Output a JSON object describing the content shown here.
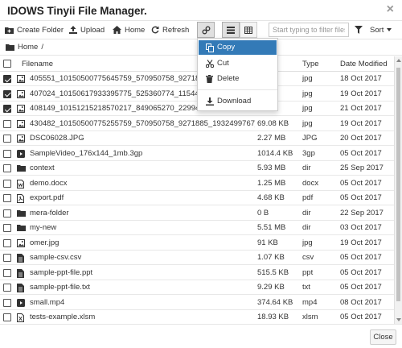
{
  "window": {
    "title": "IDOWS Tinyii File Manager.",
    "close_glyph": "×"
  },
  "toolbar": {
    "create_folder": "Create Folder",
    "upload": "Upload",
    "home": "Home",
    "refresh": "Refresh",
    "filter_placeholder": "Start typing to filter files.",
    "sort": "Sort"
  },
  "breadcrumb": {
    "home": "Home",
    "separator": "/"
  },
  "grid": {
    "columns": {
      "filename": "Filename",
      "size": "",
      "type": "Type",
      "date": "Date Modified"
    },
    "rows": [
      {
        "name": "405551_10150500775645759_570950758_9271888_",
        "size": "KB",
        "type": "jpg",
        "date": "18 Oct 2017",
        "icon": "image-icon",
        "checked": true
      },
      {
        "name": "407024_10150617933395775_525360774_11544833",
        "size": "KB",
        "type": "jpg",
        "date": "19 Oct 2017",
        "icon": "image-icon",
        "checked": true
      },
      {
        "name": "408149_10151215218570217_849065270_2299490",
        "size": "KB",
        "type": "jpg",
        "date": "21 Oct 2017",
        "icon": "image-icon",
        "checked": true
      },
      {
        "name": "430482_10150500775255759_570950758_9271885_1932499767_n.jpg",
        "size": "69.08 KB",
        "type": "jpg",
        "date": "19 Oct 2017",
        "icon": "image-icon",
        "checked": false
      },
      {
        "name": "DSC06028.JPG",
        "size": "2.27 MB",
        "type": "JPG",
        "date": "20 Oct 2017",
        "icon": "image-icon",
        "checked": false
      },
      {
        "name": "SampleVideo_176x144_1mb.3gp",
        "size": "1014.4 KB",
        "type": "3gp",
        "date": "05 Oct 2017",
        "icon": "video-icon",
        "checked": false
      },
      {
        "name": "context",
        "size": "5.93 MB",
        "type": "dir",
        "date": "25 Sep 2017",
        "icon": "folder-icon",
        "checked": false
      },
      {
        "name": "demo.docx",
        "size": "1.25 MB",
        "type": "docx",
        "date": "05 Oct 2017",
        "icon": "word-icon",
        "checked": false
      },
      {
        "name": "export.pdf",
        "size": "4.68 KB",
        "type": "pdf",
        "date": "05 Oct 2017",
        "icon": "pdf-icon",
        "checked": false
      },
      {
        "name": "mera-folder",
        "size": "0 B",
        "type": "dir",
        "date": "22 Sep 2017",
        "icon": "folder-icon",
        "checked": false
      },
      {
        "name": "my-new",
        "size": "5.51 MB",
        "type": "dir",
        "date": "03 Oct 2017",
        "icon": "folder-icon",
        "checked": false
      },
      {
        "name": "omer.jpg",
        "size": "91 KB",
        "type": "jpg",
        "date": "19 Oct 2017",
        "icon": "image-icon",
        "checked": false
      },
      {
        "name": "sample-csv.csv",
        "size": "1.07 KB",
        "type": "csv",
        "date": "05 Oct 2017",
        "icon": "file-icon",
        "checked": false
      },
      {
        "name": "sample-ppt-file.ppt",
        "size": "515.5 KB",
        "type": "ppt",
        "date": "05 Oct 2017",
        "icon": "file-icon",
        "checked": false
      },
      {
        "name": "sample-ppt-file.txt",
        "size": "9.29 KB",
        "type": "txt",
        "date": "05 Oct 2017",
        "icon": "file-icon",
        "checked": false
      },
      {
        "name": "small.mp4",
        "size": "374.64 KB",
        "type": "mp4",
        "date": "08 Oct 2017",
        "icon": "video-icon",
        "checked": false
      },
      {
        "name": "tests-example.xlsm",
        "size": "18.93 KB",
        "type": "xlsm",
        "date": "05 Oct 2017",
        "icon": "excel-icon",
        "checked": false
      }
    ]
  },
  "context_menu": {
    "items": [
      {
        "label": "Copy",
        "icon": "copy-icon",
        "highlighted": true
      },
      {
        "label": "Cut",
        "icon": "scissors-icon",
        "highlighted": false
      },
      {
        "label": "Delete",
        "icon": "trash-icon",
        "highlighted": false
      },
      {
        "label": "Download",
        "icon": "download-icon",
        "highlighted": false
      }
    ]
  },
  "footer": {
    "close": "Close"
  },
  "colors": {
    "accent": "#337ab7",
    "text": "#333333",
    "border": "#cccccc"
  }
}
